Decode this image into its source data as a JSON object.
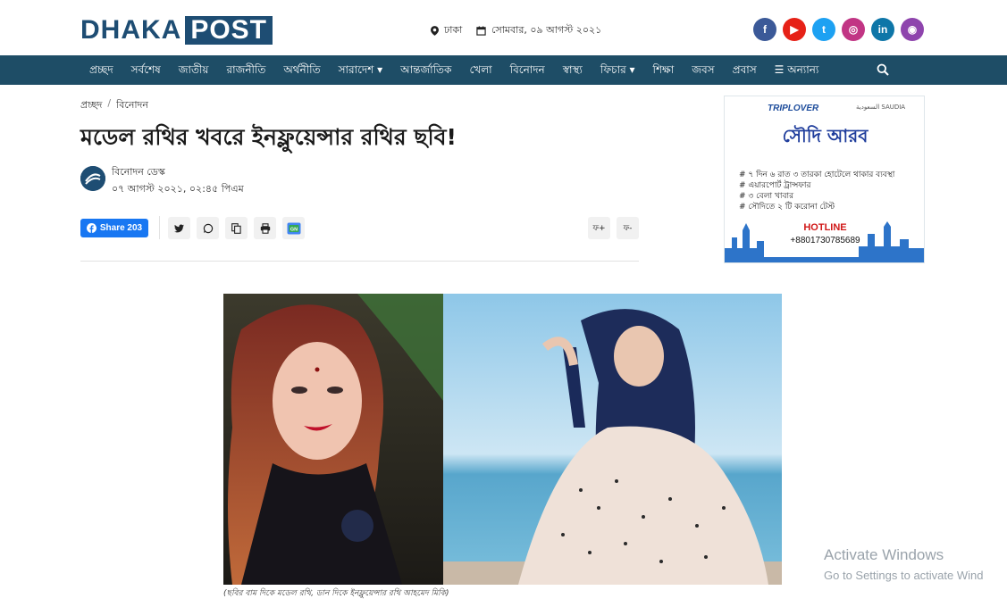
{
  "header": {
    "logo_left": "DHAKA",
    "logo_right": "POST",
    "location": "ঢাকা",
    "date": "সোমবার, ০৯ আগস্ট ২০২১",
    "socials": [
      {
        "name": "facebook",
        "glyph": "f",
        "color": "#3b5998"
      },
      {
        "name": "youtube",
        "glyph": "▶",
        "color": "#e62117"
      },
      {
        "name": "twitter",
        "glyph": "t",
        "color": "#1da1f2"
      },
      {
        "name": "instagram",
        "glyph": "◎",
        "color": "#c13584"
      },
      {
        "name": "linkedin",
        "glyph": "in",
        "color": "#0e76a8"
      },
      {
        "name": "podcast",
        "glyph": "◉",
        "color": "#8e44ad"
      }
    ]
  },
  "nav": {
    "items": [
      {
        "label": "প্রচ্ছদ"
      },
      {
        "label": "সর্বশেষ"
      },
      {
        "label": "জাতীয়"
      },
      {
        "label": "রাজনীতি"
      },
      {
        "label": "অর্থনীতি"
      },
      {
        "label": "সারাদেশ ▾"
      },
      {
        "label": "আন্তর্জাতিক"
      },
      {
        "label": "খেলা"
      },
      {
        "label": "বিনোদন"
      },
      {
        "label": "স্বাস্থ্য"
      },
      {
        "label": "ফিচার ▾"
      },
      {
        "label": "শিক্ষা"
      },
      {
        "label": "জবস"
      },
      {
        "label": "প্রবাস"
      },
      {
        "label": "☰ অন্যান্য"
      }
    ]
  },
  "article": {
    "breadcrumb": [
      "প্রচ্ছদ",
      "/",
      "বিনোদন"
    ],
    "title": "মডেল রথির খবরে ইনফ্লুয়েন্সার রথির ছবি!",
    "author": "বিনোদন ডেস্ক",
    "published": "০৭ আগস্ট ২০২১, ০২:৪৫ পিএম",
    "share_label": "Share 203",
    "font_increase": "ফ+",
    "font_decrease": "ফ-",
    "caption": "(ছবির বাম দিকে মডেল রথি, ডান দিকে ইনফ্লুয়েন্সার রথি আহমেদ মিকি)"
  },
  "ad": {
    "brand": "TRIPLOVER",
    "partner": "السعودية SAUDIA",
    "headline": "সৌদি আরব",
    "lines": [
      "# ৭ দিন ৬ রাত ৩ তারকা হোটেলে থাকার ব্যবস্থা",
      "# এয়ারপোর্ট ট্রান্সফার",
      "# ৩ বেলা খাবার",
      "# সৌদিতে ২ টি করোনা টেস্ট"
    ],
    "hotline_label": "HOTLINE",
    "phone": "+8801730785689"
  },
  "watermark": {
    "line1": "Activate Windows",
    "line2": "Go to Settings to activate Wind"
  },
  "colors": {
    "brand": "#1e4d73",
    "nav_bg": "#1e4d66",
    "facebook_share": "#1877f2"
  }
}
